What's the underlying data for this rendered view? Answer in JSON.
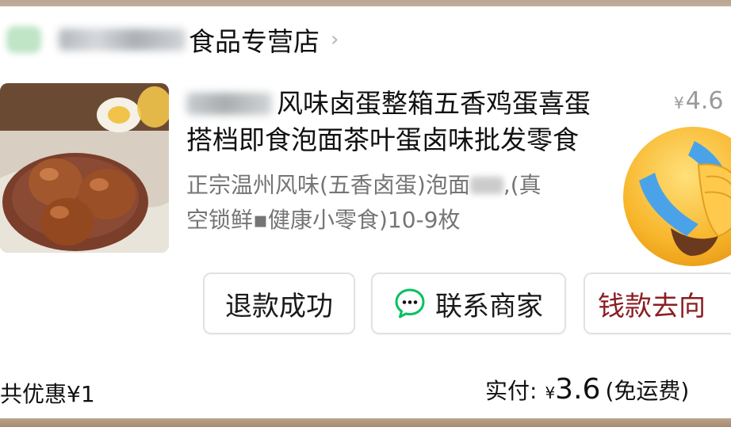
{
  "store": {
    "name": "食品专营店",
    "arrow": "›"
  },
  "product": {
    "title_line1": "风味卤蛋整箱五香鸡蛋喜蛋",
    "title_line2": "搭档即食泡面茶叶蛋卤味批发零食",
    "desc_line1_a": "正宗温州风味(五香卤蛋)泡面",
    "desc_line1_b": ",(真",
    "desc_line2": "空锁鲜▪健康小零食)10-9枚",
    "price_symbol": "¥",
    "price": "4.6"
  },
  "actions": {
    "refund_label": "退款成功",
    "contact_label": "联系商家",
    "money_label": "钱款去向"
  },
  "summary": {
    "discount_text": "共优惠¥1",
    "paid_label": "实付:",
    "paid_symbol": "¥",
    "paid_amount": "3.6",
    "shipping_note": "(免运费)"
  },
  "colors": {
    "money_button_text": "#8b1e22",
    "wechat_green": "#07c160"
  },
  "icons": {
    "emoji": "face-palm-crying-emoji",
    "chat": "chat-bubble-icon"
  }
}
